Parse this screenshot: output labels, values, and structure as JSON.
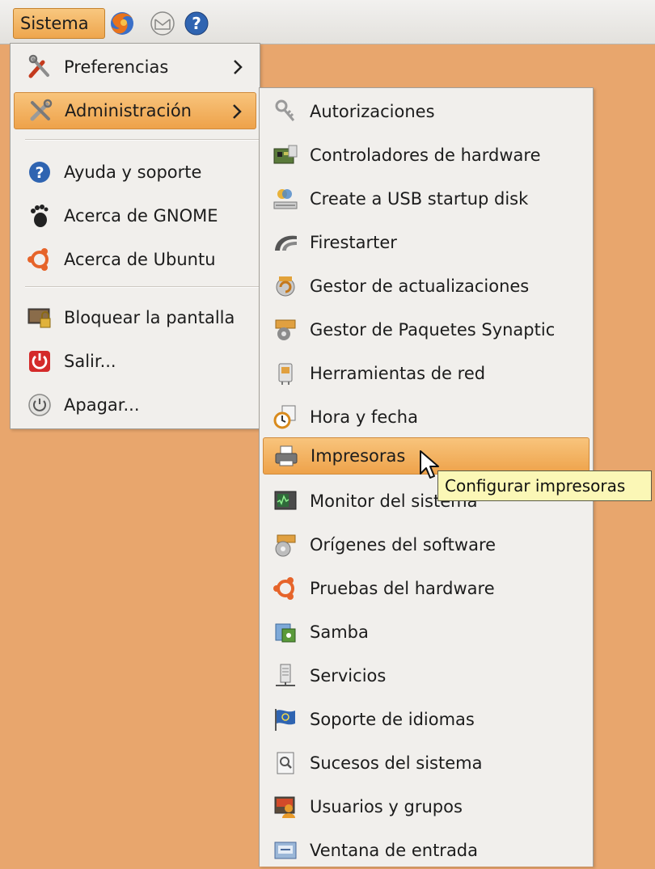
{
  "panel": {
    "menu_label": "Sistema",
    "launchers": [
      "firefox-icon",
      "mail-icon",
      "help-icon"
    ]
  },
  "main_menu": {
    "items": [
      {
        "label": "Preferencias",
        "icon": "preferences-icon",
        "submenu": true
      },
      {
        "label": "Administración",
        "icon": "administration-icon",
        "submenu": true,
        "highlighted": true
      },
      {
        "label": "Ayuda y soporte",
        "icon": "help-icon"
      },
      {
        "label": "Acerca de GNOME",
        "icon": "gnome-foot-icon"
      },
      {
        "label": "Acerca de Ubuntu",
        "icon": "ubuntu-logo-icon"
      },
      {
        "label": "Bloquear la pantalla",
        "icon": "lock-screen-icon"
      },
      {
        "label": "Salir...",
        "icon": "logout-icon"
      },
      {
        "label": "Apagar...",
        "icon": "shutdown-icon"
      }
    ]
  },
  "admin_menu": {
    "items": [
      {
        "label": "Autorizaciones",
        "icon": "keys-icon"
      },
      {
        "label": "Controladores de hardware",
        "icon": "hardware-drivers-icon"
      },
      {
        "label": "Create a USB startup disk",
        "icon": "usb-disk-icon"
      },
      {
        "label": "Firestarter",
        "icon": "firestarter-icon"
      },
      {
        "label": "Gestor de actualizaciones",
        "icon": "update-manager-icon"
      },
      {
        "label": "Gestor de Paquetes Synaptic",
        "icon": "synaptic-icon"
      },
      {
        "label": "Herramientas de red",
        "icon": "network-tools-icon"
      },
      {
        "label": "Hora y fecha",
        "icon": "clock-icon"
      },
      {
        "label": "Impresoras",
        "icon": "printer-icon",
        "highlighted": true
      },
      {
        "label": "Monitor del sistema",
        "icon": "system-monitor-icon"
      },
      {
        "label": "Orígenes del software",
        "icon": "software-sources-icon"
      },
      {
        "label": "Pruebas del hardware",
        "icon": "hardware-test-icon"
      },
      {
        "label": "Samba",
        "icon": "samba-icon"
      },
      {
        "label": "Servicios",
        "icon": "services-icon"
      },
      {
        "label": "Soporte de idiomas",
        "icon": "language-support-icon"
      },
      {
        "label": "Sucesos del sistema",
        "icon": "system-log-icon"
      },
      {
        "label": "Usuarios y grupos",
        "icon": "users-groups-icon"
      },
      {
        "label": "Ventana de entrada",
        "icon": "login-window-icon"
      }
    ]
  },
  "tooltip": {
    "text": "Configurar impresoras"
  },
  "colors": {
    "desktop": "#e8a66d",
    "highlight": "#eea24a",
    "menu_bg": "#f1efec",
    "tooltip_bg": "#fbf7b6"
  }
}
